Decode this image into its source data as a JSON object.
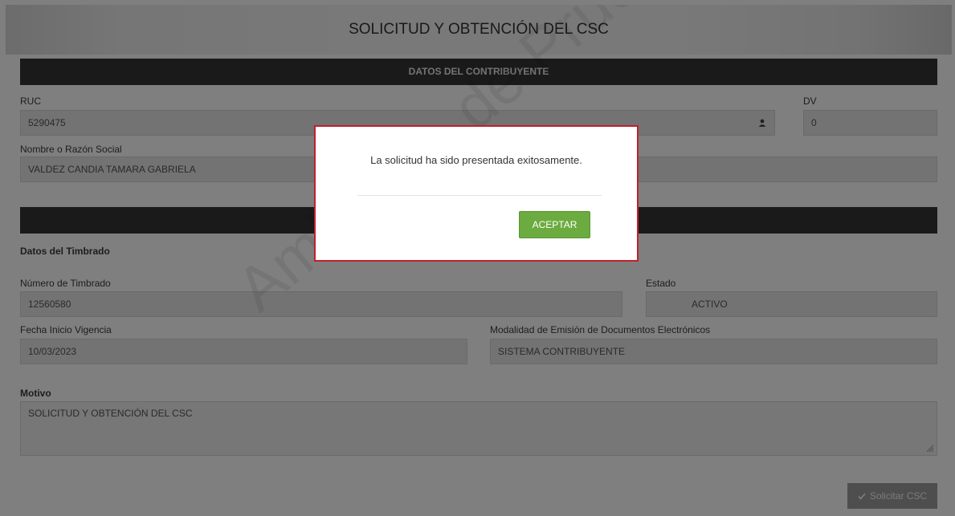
{
  "page": {
    "title": "SOLICITUD Y OBTENCIÓN DEL CSC"
  },
  "section1": {
    "title": "DATOS DEL CONTRIBUYENTE"
  },
  "contribuyente": {
    "ruc_label": "RUC",
    "ruc_value": "5290475",
    "dv_label": "DV",
    "dv_value": "0",
    "nombre_label": "Nombre o Razón Social",
    "nombre_value": "VALDEZ CANDIA TAMARA GABRIELA"
  },
  "timbrado": {
    "heading": "Datos del Timbrado",
    "numero_label": "Número de Timbrado",
    "numero_value": "12560580",
    "estado_label": "Estado",
    "estado_value": "ACTIVO",
    "fecha_label": "Fecha Inicio Vigencia",
    "fecha_value": "10/03/2023",
    "modalidad_label": "Modalidad de Emisión de Documentos Electrónicos",
    "modalidad_value": "SISTEMA CONTRIBUYENTE"
  },
  "motivo": {
    "label": "Motivo",
    "value": "SOLICITUD Y OBTENCIÓN DEL CSC"
  },
  "actions": {
    "submit_label": "Solicitar CSC",
    "submit_icon": "check-icon"
  },
  "watermark": {
    "text": "Ambiente de Pruebas"
  },
  "modal": {
    "message": "La solicitud ha sido presentada exitosamente.",
    "accept_label": "ACEPTAR",
    "border_color": "#c0202a",
    "accept_color": "#6cab3f"
  },
  "icons": {
    "user": "user-icon",
    "resize": "resize-grip-icon"
  }
}
